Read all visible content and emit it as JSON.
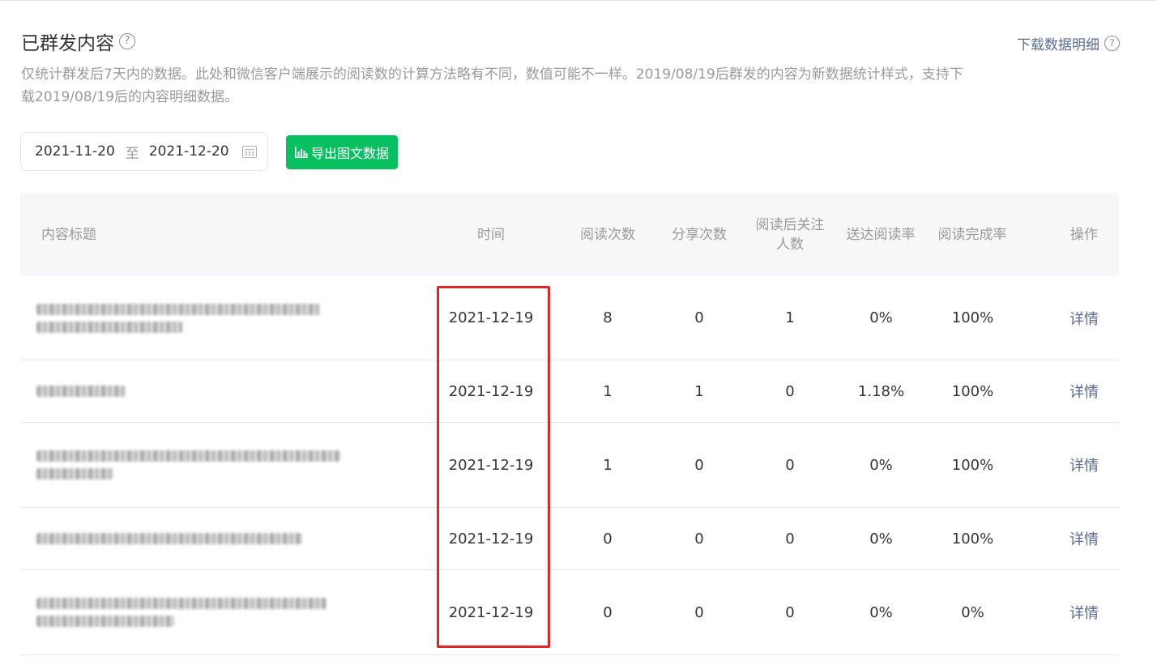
{
  "header": {
    "title": "已群发内容",
    "download_label": "下载数据明细",
    "description": "仅统计群发后7天内的数据。此处和微信客户端展示的阅读数的计算方法略有不同，数值可能不一样。2019/08/19后群发的内容为新数据统计样式，支持下载2019/08/19后的内容明细数据。"
  },
  "date_range": {
    "start": "2021-11-20",
    "separator": "至",
    "end": "2021-12-20"
  },
  "export_label": "导出图文数据",
  "table": {
    "headers": {
      "title": "内容标题",
      "time": "时间",
      "reads": "阅读次数",
      "shares": "分享次数",
      "follows": "阅读后关注人数",
      "delivery_rate": "送达阅读率",
      "completion_rate": "阅读完成率",
      "action": "操作"
    },
    "rows": [
      {
        "time": "2021-12-19",
        "reads": "8",
        "shares": "0",
        "follows": "1",
        "delivery_rate": "0%",
        "completion_rate": "100%",
        "action": "详情"
      },
      {
        "time": "2021-12-19",
        "reads": "1",
        "shares": "1",
        "follows": "0",
        "delivery_rate": "1.18%",
        "completion_rate": "100%",
        "action": "详情"
      },
      {
        "time": "2021-12-19",
        "reads": "1",
        "shares": "0",
        "follows": "0",
        "delivery_rate": "0%",
        "completion_rate": "100%",
        "action": "详情"
      },
      {
        "time": "2021-12-19",
        "reads": "0",
        "shares": "0",
        "follows": "0",
        "delivery_rate": "0%",
        "completion_rate": "100%",
        "action": "详情"
      },
      {
        "time": "2021-12-19",
        "reads": "0",
        "shares": "0",
        "follows": "0",
        "delivery_rate": "0%",
        "completion_rate": "0%",
        "action": "详情"
      }
    ]
  },
  "colors": {
    "accent_green": "#07c160",
    "link_blue": "#576b95",
    "highlight_red": "#e0262a"
  }
}
